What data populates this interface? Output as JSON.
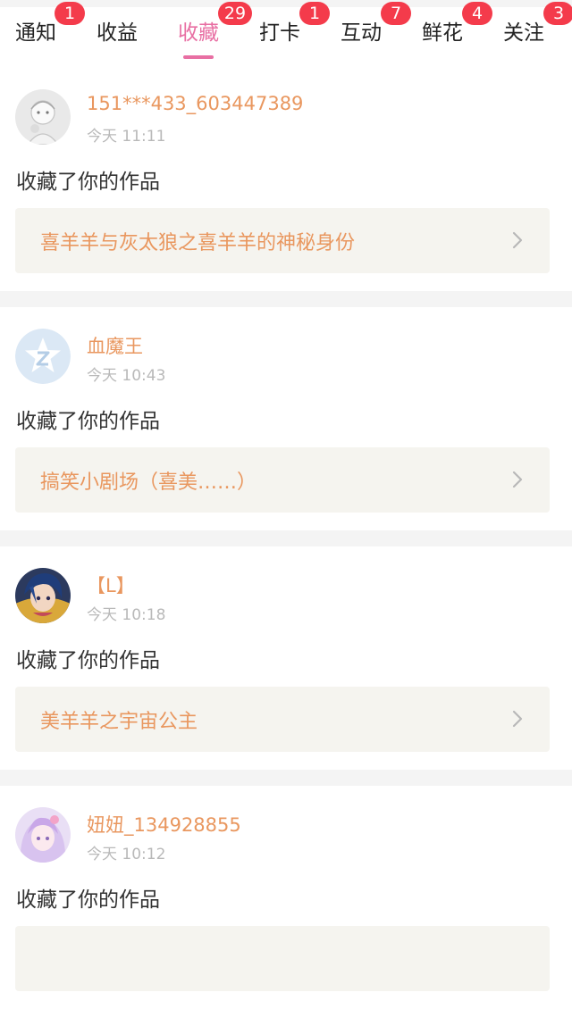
{
  "tabs": [
    {
      "label": "通知",
      "badge": "1",
      "active": false
    },
    {
      "label": "收益",
      "badge": "",
      "active": false
    },
    {
      "label": "收藏",
      "badge": "29",
      "active": true
    },
    {
      "label": "打卡",
      "badge": "1",
      "active": false
    },
    {
      "label": "互动",
      "badge": "7",
      "active": false
    },
    {
      "label": "鲜花",
      "badge": "4",
      "active": false
    },
    {
      "label": "关注",
      "badge": "3",
      "active": false
    }
  ],
  "colors": {
    "accent_pink": "#e86fa3",
    "name_orange": "#e9975f",
    "badge_red": "#f43b4b",
    "card_bg": "#f5f4ef"
  },
  "items": [
    {
      "avatar_icon": "sketch-girl-avatar",
      "username": "151***433_603447389",
      "time": "今天 11:11",
      "action": "收藏了你的作品",
      "work_title": "喜羊羊与灰太狼之喜羊羊的神秘身份"
    },
    {
      "avatar_icon": "default-star-avatar",
      "username": "血魔王",
      "time": "今天 10:43",
      "action": "收藏了你的作品",
      "work_title": "搞笑小剧场（喜美……）"
    },
    {
      "avatar_icon": "anime-blue-hair-avatar",
      "username": "【L】",
      "time": "今天 10:18",
      "action": "收藏了你的作品",
      "work_title": "美羊羊之宇宙公主"
    },
    {
      "avatar_icon": "anime-pink-hair-avatar",
      "username": "妞妞_134928855",
      "time": "今天 10:12",
      "action": "收藏了你的作品",
      "work_title": ""
    }
  ]
}
